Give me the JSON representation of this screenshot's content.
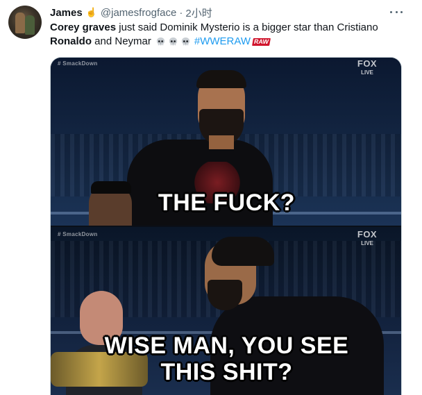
{
  "tweet": {
    "author_name": "James",
    "author_emoji": "☝️",
    "handle": "@jamesfrogface",
    "separator": "·",
    "time": "2小时",
    "text_line1_bold": "Corey graves",
    "text_line1_rest": " just said Dominik Mysterio is a bigger star than Cristiano",
    "text_line2_bold": "Ronaldo",
    "text_line2_rest": " and Neymar",
    "skull_icon_name": "skull-emoji",
    "skull_count": 3,
    "hashtag": "#WWERAW",
    "hashtag_logo_text": "RAW",
    "more_icon": "more-dots-icon"
  },
  "media": {
    "top_panel": {
      "watermark": "# SmackDown",
      "network": "FOX",
      "network_sub": "LIVE",
      "caption": "THE FUCK?"
    },
    "bottom_panel": {
      "watermark": "# SmackDown",
      "network": "FOX",
      "network_sub": "LIVE",
      "caption_line1": "WISE MAN, YOU SEE",
      "caption_line2": "THIS SHIT?"
    }
  },
  "colors": {
    "link": "#1d9bf0",
    "text": "#0f1419",
    "secondary": "#536471",
    "raw_red": "#d0142c"
  }
}
